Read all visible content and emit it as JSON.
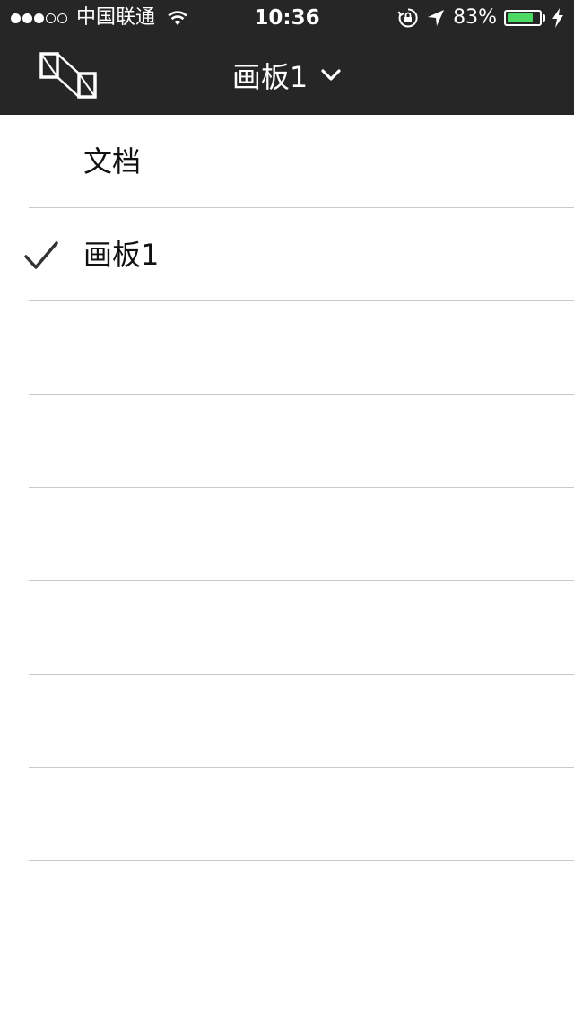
{
  "status_bar": {
    "signal_filled": 3,
    "signal_total": 5,
    "carrier": "中国联通",
    "time": "10:36",
    "battery_percent": "83%",
    "battery_level": 0.83,
    "battery_color": "#4cd964"
  },
  "nav": {
    "logo_icon": "artboard-logo-icon",
    "title": "画板1",
    "dropdown_icon": "chevron-down-icon"
  },
  "list": {
    "items": [
      {
        "label": "文档",
        "checked": false
      },
      {
        "label": "画板1",
        "checked": true
      },
      {
        "label": "",
        "checked": false
      },
      {
        "label": "",
        "checked": false
      },
      {
        "label": "",
        "checked": false
      },
      {
        "label": "",
        "checked": false
      },
      {
        "label": "",
        "checked": false
      },
      {
        "label": "",
        "checked": false
      },
      {
        "label": "",
        "checked": false
      }
    ]
  },
  "colors": {
    "topbar_bg": "#262626",
    "divider": "#c8c8c8",
    "check": "#333333"
  }
}
